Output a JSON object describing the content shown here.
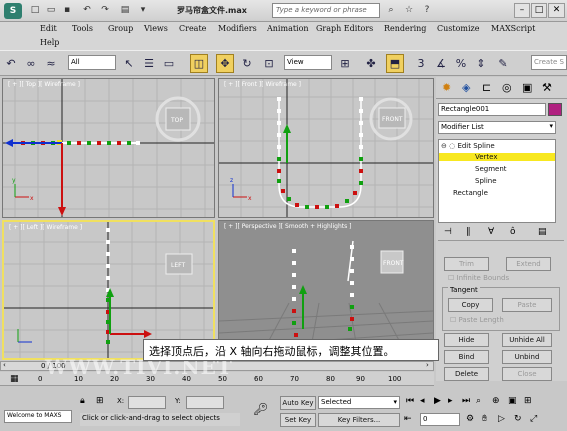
{
  "titlebar": {
    "title": "罗马帘盒文件.max",
    "search_placeholder": "Type a keyword or phrase"
  },
  "menubar": {
    "items": [
      "Edit",
      "Tools",
      "Group",
      "Views",
      "Create",
      "Modifiers",
      "Animation",
      "Graph Editors",
      "Rendering",
      "Customize",
      "MAXScript",
      "Help"
    ]
  },
  "toolbar": {
    "selection_filter": "All",
    "ref_coord": "View",
    "create_selection": "Create S"
  },
  "viewports": {
    "top": "[ + ][ Top ][ Wireframe ]",
    "front": "[ + ][ Front ][ Wireframe ]",
    "left": "[ + ][ Left ][ Wireframe ]",
    "perspective": "[ + ][ Perspective ][ Smooth + Highlights ]",
    "top_cube": "TOP",
    "front_cube": "FRONT",
    "left_cube": "LEFT",
    "persp_cube": "FRONT"
  },
  "cmdpanel": {
    "object_name": "Rectangle001",
    "modifier_list": "Modifier List",
    "stack": [
      "Edit Spline",
      "Vertex",
      "Segment",
      "Spline",
      "Rectangle"
    ],
    "trim": "Trim",
    "extend": "Extend",
    "infinite_bounds": "Infinite Bounds",
    "tangent_label": "Tangent",
    "copy": "Copy",
    "paste": "Paste",
    "paste_length": "Paste Length",
    "hide": "Hide",
    "unhide_all": "Unhide All",
    "bind": "Bind",
    "unbind": "Unbind",
    "delete": "Delete",
    "close": "Close"
  },
  "timeline": {
    "frame": "0 / 100",
    "ticks": [
      "0",
      "10",
      "20",
      "30",
      "40",
      "50",
      "60",
      "70",
      "80",
      "90",
      "100"
    ]
  },
  "status": {
    "welcome": "Welcome to MAXS",
    "x_label": "X:",
    "y_label": "Y:",
    "prompt": "Click or click-and-drag to select objects",
    "auto_key": "Auto Key",
    "set_key": "Set Key",
    "selected": "Selected",
    "key_filters": "Key Filters...",
    "frame_field": "0"
  },
  "overlay": {
    "subtitle": "选择顶点后，沿 X 轴向右拖动鼠标，调整其位置。",
    "watermark": "WWW.TIVI.NET"
  },
  "colors": {
    "accent": "#f0e060",
    "vertex_red": "#cc1010",
    "vertex_green": "#10a010"
  }
}
